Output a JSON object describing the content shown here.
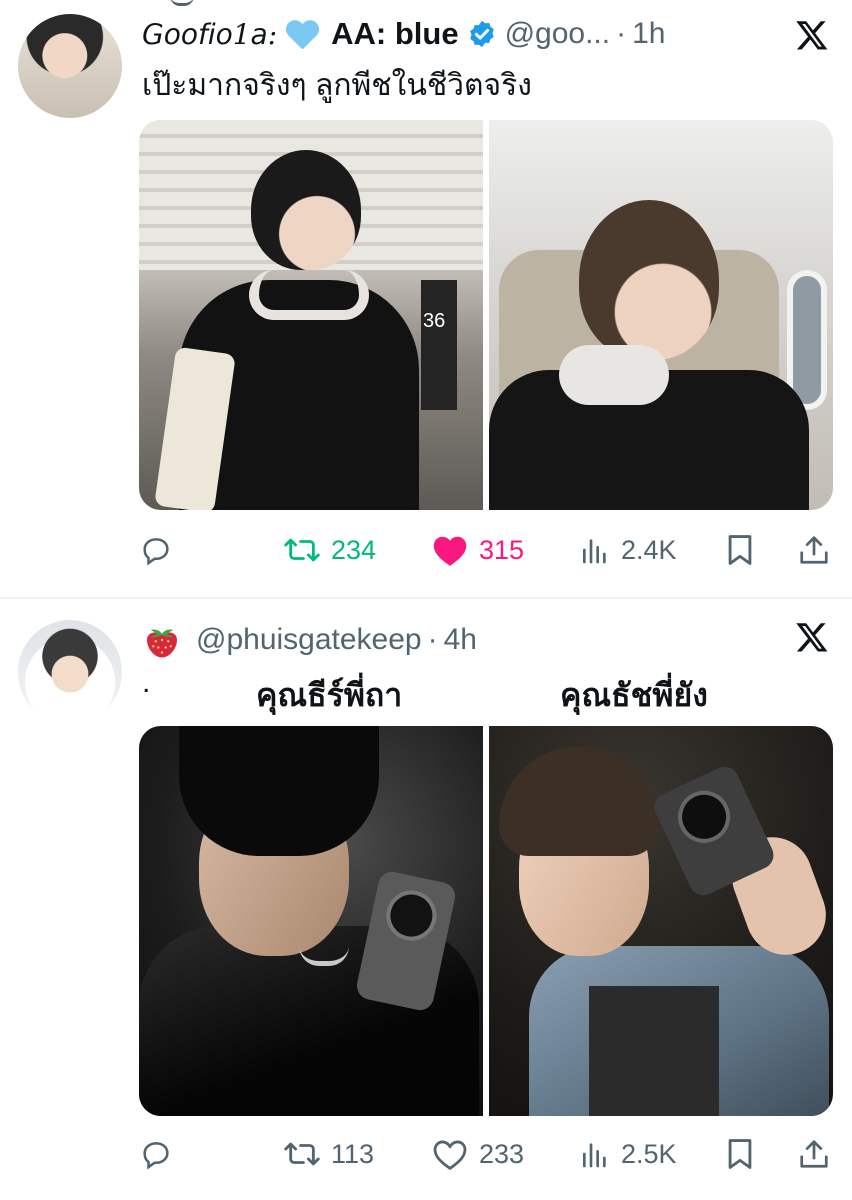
{
  "tweet1": {
    "display_name": "𝘎𝘰𝘰𝘧𝘪𝘰1𝘢:",
    "display_name_2": "AA: blue",
    "handle": "@goo...",
    "time": "1h",
    "text": "เป๊ะมากจริงๆ ลูกพีชในชีวิตจริง",
    "actions": {
      "replies": "",
      "retweets": "234",
      "likes": "315",
      "views": "2.4K"
    },
    "colors": {
      "retweet": "#00ba7c",
      "like": "#f91880",
      "verified": "#1d9bf0"
    }
  },
  "tweet2": {
    "handle": "@phuisgatekeep",
    "time": "4h",
    "text": ".",
    "caption_left": "คุณธีร์พี่ถา",
    "caption_right": "คุณธัชพี่ยัง",
    "actions": {
      "replies": "",
      "retweets": "113",
      "likes": "233",
      "views": "2.5K"
    }
  },
  "separator": "·",
  "icons": [
    "reply-icon",
    "retweet-icon",
    "like-icon",
    "views-icon",
    "bookmark-icon",
    "share-icon",
    "x-logo-icon",
    "verified-icon",
    "strawberry-icon",
    "blue-heart-icon"
  ]
}
